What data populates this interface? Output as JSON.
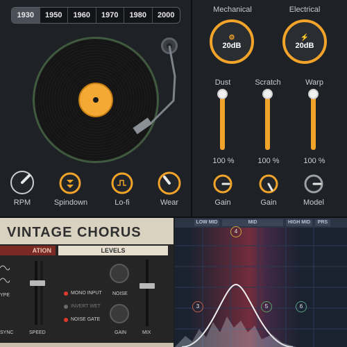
{
  "years": {
    "items": [
      "1930",
      "1950",
      "1960",
      "1970",
      "1980",
      "2000"
    ],
    "active": "1930"
  },
  "left_knobs": [
    {
      "label": "RPM"
    },
    {
      "label": "Spindown"
    },
    {
      "label": "Lo-fi"
    },
    {
      "label": "Wear"
    }
  ],
  "right_panel": {
    "mechanical": {
      "label": "Mechanical",
      "value": "20dB"
    },
    "electrical": {
      "label": "Electrical",
      "value": "20dB"
    },
    "sliders": [
      {
        "label": "Dust",
        "value": "100 %"
      },
      {
        "label": "Scratch",
        "value": "100 %"
      },
      {
        "label": "Warp",
        "value": "100 %"
      }
    ],
    "knobs": [
      {
        "label": "Gain"
      },
      {
        "label": "Gain"
      },
      {
        "label": "Model"
      }
    ]
  },
  "chorus": {
    "title": "VINTAGE CHORUS",
    "section_left": "ATION",
    "section_levels": "LEVELS",
    "type_label": "YPE",
    "sync_label": "SYNC",
    "speed_label": "SPEED",
    "mono_input": "MONO INPUT",
    "invert_wet": "INVERT WET",
    "noise_gate": "NOISE GATE",
    "noise": "NOISE",
    "gain": "GAIN",
    "mix": "MIX"
  },
  "eq": {
    "bands": [
      "LOW MID",
      "MID",
      "HIGH MID",
      "PRS"
    ],
    "nodes": [
      "3",
      "4",
      "5",
      "6"
    ],
    "colors": {
      "node3": "#c0604a",
      "node4": "#d8a040",
      "node5": "#5aa060",
      "node6": "#5aa080"
    }
  }
}
